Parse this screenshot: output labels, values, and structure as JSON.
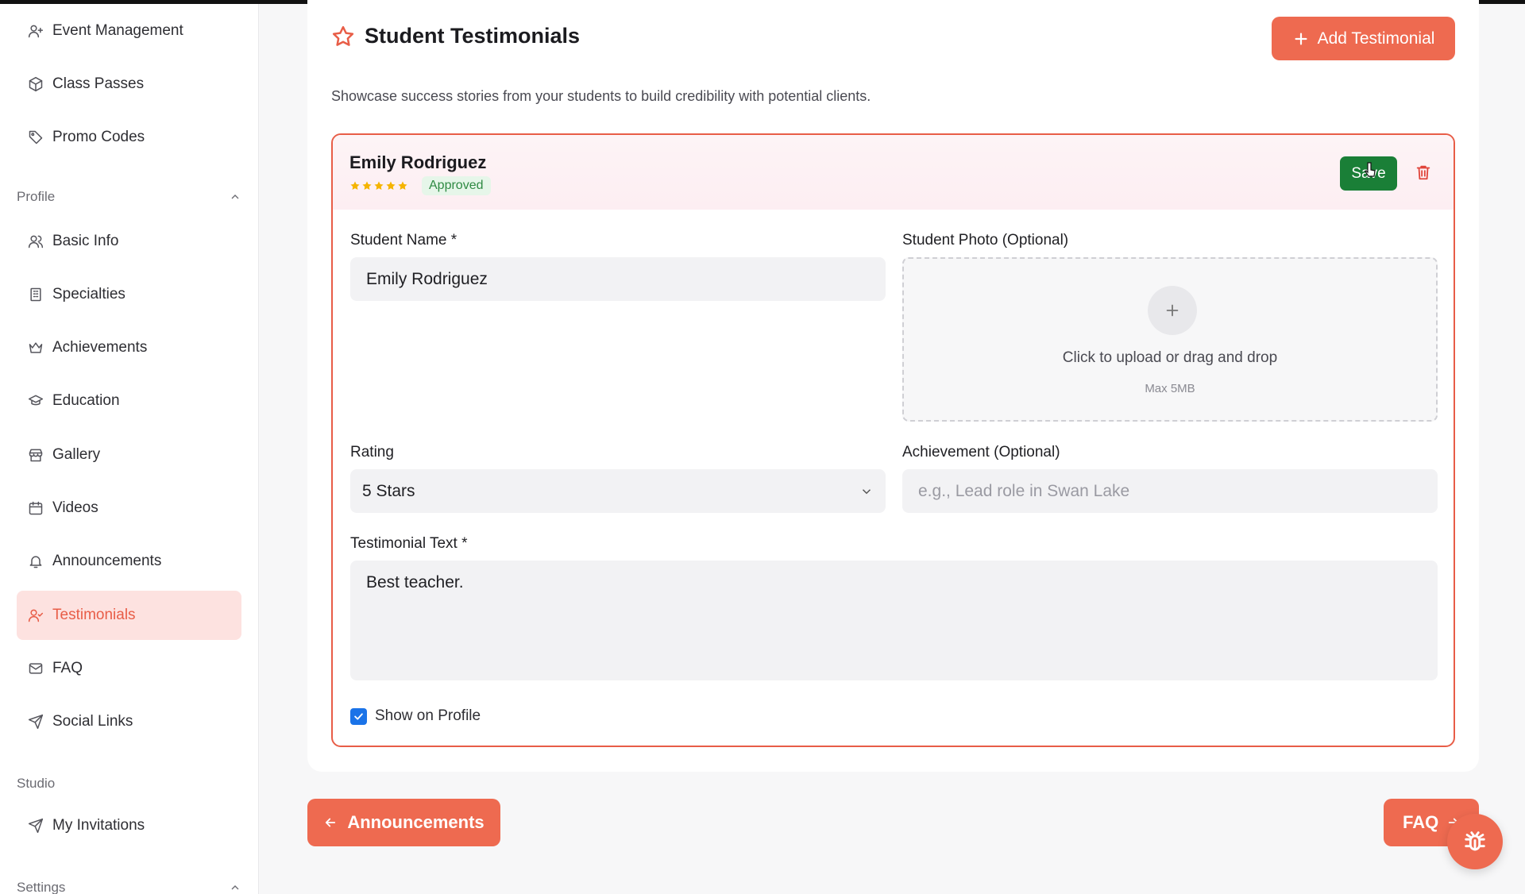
{
  "sidebar": {
    "top_items": [
      {
        "label": "Event Management",
        "icon": "user-plus-icon"
      },
      {
        "label": "Class Passes",
        "icon": "package-icon"
      },
      {
        "label": "Promo Codes",
        "icon": "tag-icon"
      }
    ],
    "profile_section": {
      "label": "Profile",
      "items": [
        {
          "label": "Basic Info",
          "icon": "users-icon"
        },
        {
          "label": "Specialties",
          "icon": "building-icon"
        },
        {
          "label": "Achievements",
          "icon": "crown-icon"
        },
        {
          "label": "Education",
          "icon": "graduation-cap-icon"
        },
        {
          "label": "Gallery",
          "icon": "store-icon"
        },
        {
          "label": "Videos",
          "icon": "calendar-icon"
        },
        {
          "label": "Announcements",
          "icon": "bell-icon"
        },
        {
          "label": "Testimonials",
          "icon": "user-check-icon",
          "active": true
        },
        {
          "label": "FAQ",
          "icon": "mail-icon"
        },
        {
          "label": "Social Links",
          "icon": "send-icon"
        }
      ]
    },
    "studio_section": {
      "label": "Studio",
      "items": [
        {
          "label": "My Invitations",
          "icon": "send-icon"
        }
      ]
    },
    "settings_section": {
      "label": "Settings"
    }
  },
  "main": {
    "title": "Student Testimonials",
    "title_icon": "star-icon",
    "subtitle": "Showcase success stories from your students to build credibility with potential clients.",
    "add_button": "Add Testimonial"
  },
  "testimonial": {
    "name": "Emily Rodriguez",
    "rating": 5,
    "status": "Approved",
    "save_label": "Save",
    "student_name_label": "Student Name *",
    "student_name_value": "Emily Rodriguez",
    "photo_label": "Student Photo (Optional)",
    "upload_text": "Click to upload or drag and drop",
    "upload_max": "Max 5MB",
    "rating_label": "Rating",
    "rating_value": "5 Stars",
    "achievement_label": "Achievement (Optional)",
    "achievement_placeholder": "e.g., Lead role in Swan Lake",
    "text_label": "Testimonial Text *",
    "text_value": "Best teacher.",
    "show_on_profile_label": "Show on Profile",
    "show_on_profile": true
  },
  "footer_nav": {
    "prev_label": "Announcements",
    "next_label": "FAQ"
  },
  "colors": {
    "accent": "#ee6a50",
    "save_green": "#1a7f37",
    "approved_green": "#2f8a43",
    "star_gold": "#f5b400"
  }
}
